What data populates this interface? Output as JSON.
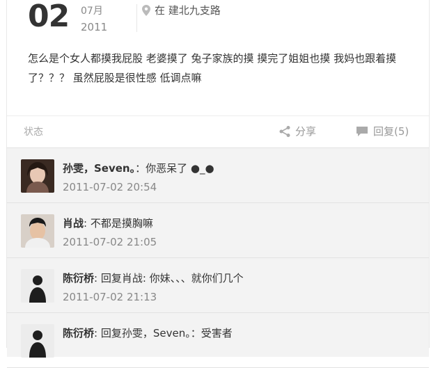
{
  "post": {
    "day": "02",
    "month": "07月",
    "year": "2011",
    "location": "在 建北九支路",
    "text": "怎么是个女人都摸我屁股 老婆摸了 兔子家族的摸 摸完了姐姐也摸 我妈也跟着摸了？？？ 虽然屁股是很性感 低调点嘛"
  },
  "status_bar": {
    "status_label": "状态",
    "share_label": "分享",
    "reply_label": "回复(5)"
  },
  "comments": [
    {
      "author": "孙雯，Seven。",
      "text": "：你恶呆了 ●_●",
      "time": "2011-07-02 20:54"
    },
    {
      "author": "肖战",
      "text": ": 不都是摸胸嘛",
      "time": "2011-07-02 21:05"
    },
    {
      "author": "陈衍桥",
      "text": ": 回复肖战: 你妹、、、就你们几个",
      "time": "2011-07-02 21:13"
    },
    {
      "author": "陈衍桥",
      "text": ": 回复孙雯，Seven。：受害者",
      "time": ""
    }
  ],
  "icons": {
    "location": "location-pin-icon",
    "share": "share-icon",
    "reply": "speech-bubble-icon"
  }
}
